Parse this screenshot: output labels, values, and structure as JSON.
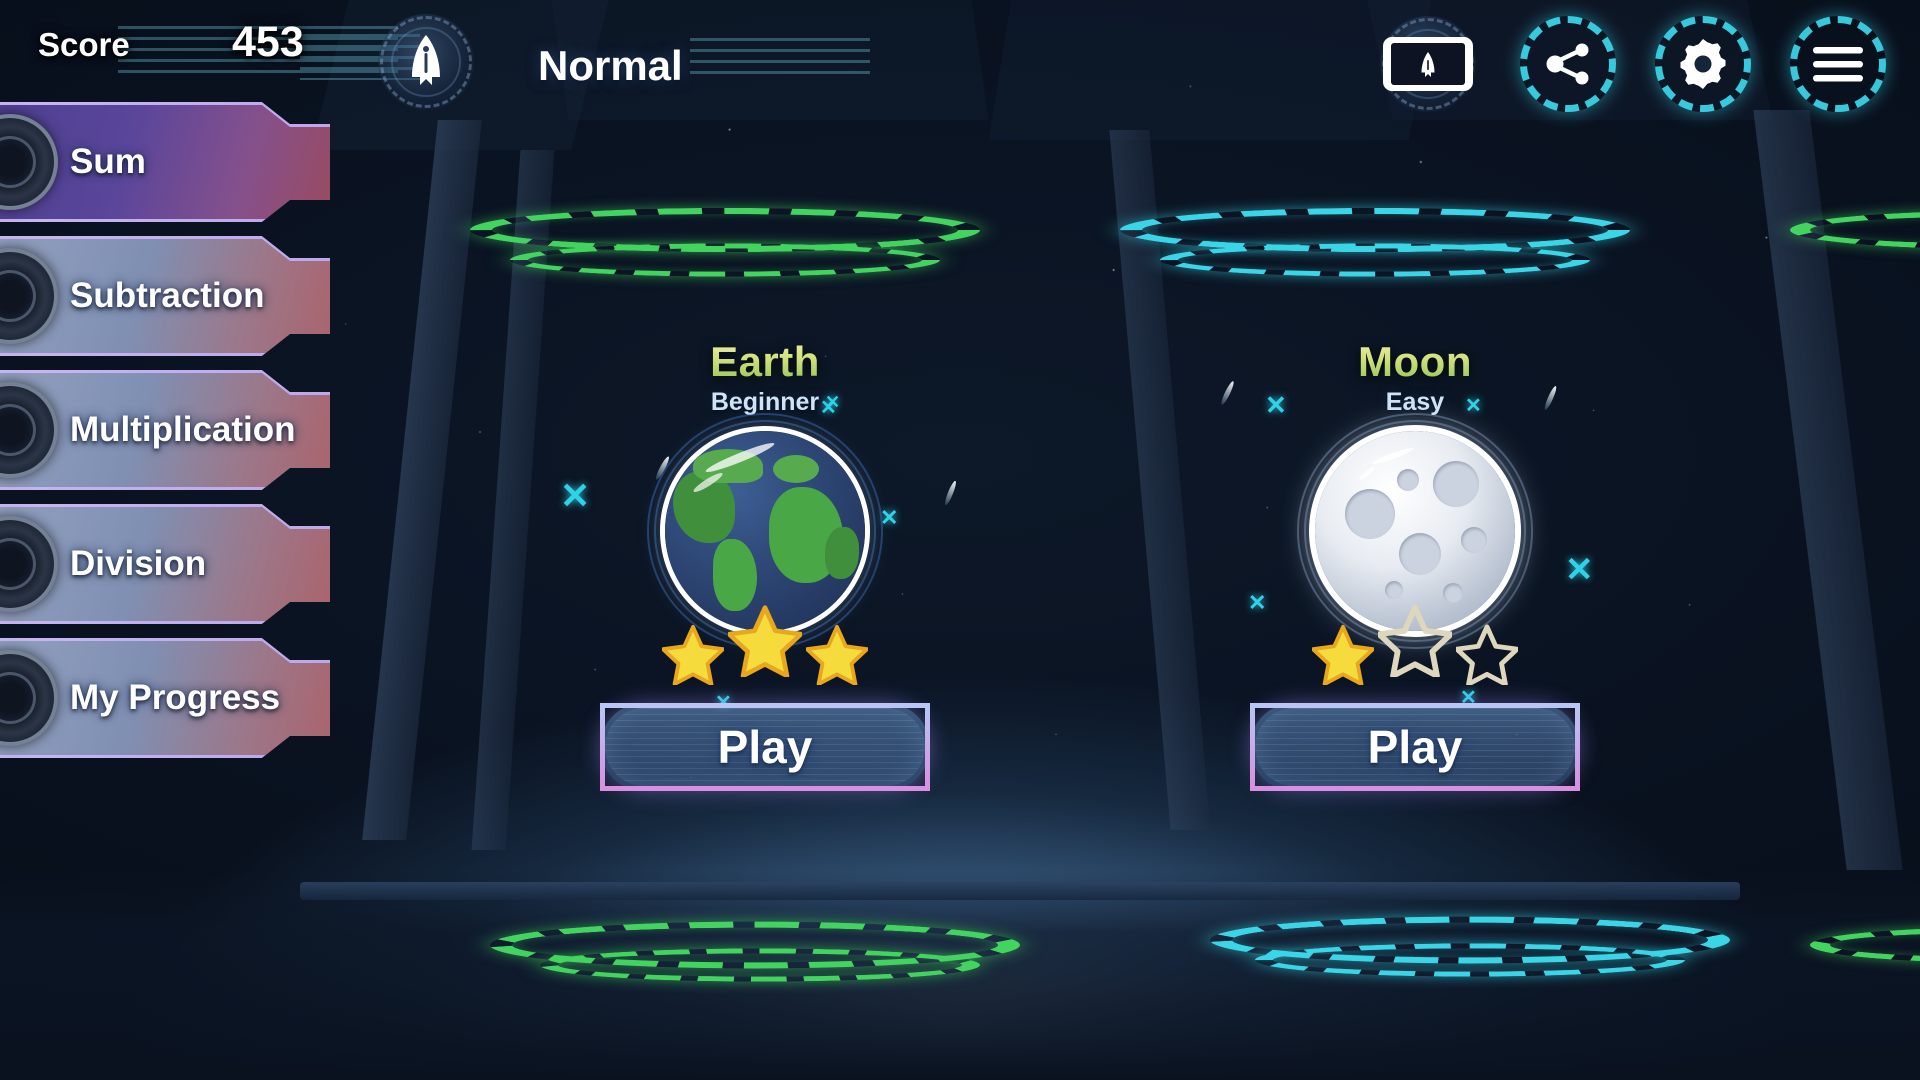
{
  "hud": {
    "score_label": "Score",
    "score_value": "453",
    "mode_label": "Normal",
    "rocket_icon": "rocket-icon",
    "device_icon": "phone-landscape-icon",
    "share_icon": "share-icon",
    "settings_icon": "gear-icon",
    "menu_icon": "hamburger-menu-icon"
  },
  "sidebar": {
    "items": [
      {
        "label": "Sum",
        "active": true
      },
      {
        "label": "Subtraction",
        "active": false
      },
      {
        "label": "Multiplication",
        "active": false
      },
      {
        "label": "Division",
        "active": false
      },
      {
        "label": "My Progress",
        "active": false
      }
    ]
  },
  "levels": [
    {
      "name": "Earth",
      "difficulty": "Beginner",
      "stars_earned": 3,
      "stars_total": 3,
      "play_label": "Play",
      "ring_color": "#43d45f",
      "planet": "earth"
    },
    {
      "name": "Moon",
      "difficulty": "Easy",
      "stars_earned": 1,
      "stars_total": 3,
      "play_label": "Play",
      "ring_color": "#3ad6e8",
      "planet": "moon"
    }
  ],
  "colors": {
    "accent_green": "#43d45f",
    "accent_cyan": "#3ad6e8",
    "star_gold": "#f5d837",
    "tab_border": "#c9b6f2",
    "play_border": "#d98fe0"
  }
}
